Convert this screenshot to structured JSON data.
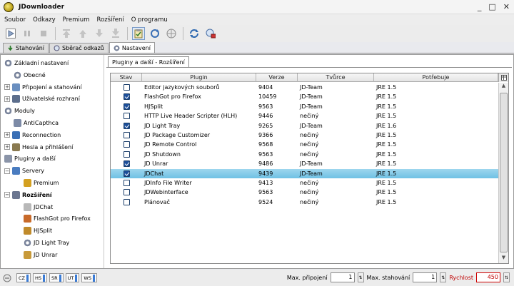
{
  "window": {
    "title": "JDownloader",
    "minimize": "_",
    "maximize": "□",
    "close": "✕"
  },
  "menu": [
    "Soubor",
    "Odkazy",
    "Premium",
    "Rozšíření",
    "O programu"
  ],
  "tabs": [
    {
      "label": "Stahování",
      "icon": "download-icon"
    },
    {
      "label": "Sběrač odkazů",
      "icon": "link-grabber-icon"
    },
    {
      "label": "Nastavení",
      "icon": "settings-icon",
      "active": true
    }
  ],
  "sidebar": {
    "items": [
      {
        "label": "Základní nastavení",
        "icon": "gear-icon",
        "indent": 0,
        "expander": ""
      },
      {
        "label": "Obecné",
        "icon": "gear-icon",
        "indent": 1,
        "expander": ""
      },
      {
        "label": "Připojení a stahování",
        "icon": "network-icon",
        "indent": 0,
        "expander": "⊞"
      },
      {
        "label": "Uživatelské rozhraní",
        "icon": "monitor-icon",
        "indent": 0,
        "expander": "⊞"
      },
      {
        "label": "Moduly",
        "icon": "gear-icon",
        "indent": 0,
        "expander": ""
      },
      {
        "label": "AntiCapthca",
        "icon": "pencil-icon",
        "indent": 1,
        "expander": ""
      },
      {
        "label": "Reconnection",
        "icon": "reconnect-icon",
        "indent": 0,
        "expander": "⊞"
      },
      {
        "label": "Hesla a přihlášení",
        "icon": "edit-icon",
        "indent": 0,
        "expander": "⊞"
      },
      {
        "label": "Pluginy a další",
        "icon": "plugin-icon",
        "indent": 0,
        "expander": ""
      },
      {
        "label": "Servery",
        "icon": "globe-icon",
        "indent": 0,
        "expander": "⊟"
      },
      {
        "label": "Premium",
        "icon": "key-icon",
        "indent": 2,
        "expander": ""
      },
      {
        "label": "Rozšíření",
        "icon": "extension-icon",
        "indent": 0,
        "expander": "⊟",
        "bold": true
      },
      {
        "label": "JDChat",
        "icon": "chat-icon",
        "indent": 2,
        "expander": ""
      },
      {
        "label": "FlashGot pro Firefox",
        "icon": "flashgot-icon",
        "indent": 2,
        "expander": ""
      },
      {
        "label": "HJSplit",
        "icon": "split-icon",
        "indent": 2,
        "expander": ""
      },
      {
        "label": "JD Light Tray",
        "icon": "gear-icon",
        "indent": 2,
        "expander": ""
      },
      {
        "label": "JD Unrar",
        "icon": "archive-icon",
        "indent": 2,
        "expander": ""
      }
    ]
  },
  "panel": {
    "tab_label": "Pluginy a další - Rozšíření"
  },
  "table": {
    "columns": [
      "Stav",
      "Plugin",
      "Verze",
      "Tvůrce",
      "Potřebuje"
    ],
    "rows": [
      {
        "checked": false,
        "plugin": "Editor jazykových souborů",
        "version": "9404",
        "author": "JD-Team",
        "requires": "JRE 1.5"
      },
      {
        "checked": true,
        "plugin": "FlashGot pro Firefox",
        "version": "10459",
        "author": "JD-Team",
        "requires": "JRE 1.5"
      },
      {
        "checked": true,
        "plugin": "HJSplit",
        "version": "9563",
        "author": "JD-Team",
        "requires": "JRE 1.5"
      },
      {
        "checked": false,
        "plugin": "HTTP Live Header Scripter (HLH)",
        "version": "9446",
        "author": "nečiný",
        "requires": "JRE 1.5"
      },
      {
        "checked": true,
        "plugin": "JD Light Tray",
        "version": "9265",
        "author": "JD-Team",
        "requires": "JRE 1.6"
      },
      {
        "checked": false,
        "plugin": "JD Package Customizer",
        "version": "9366",
        "author": "nečiný",
        "requires": "JRE 1.5"
      },
      {
        "checked": false,
        "plugin": "JD Remote Control",
        "version": "9568",
        "author": "nečiný",
        "requires": "JRE 1.5"
      },
      {
        "checked": false,
        "plugin": "JD Shutdown",
        "version": "9563",
        "author": "nečiný",
        "requires": "JRE 1.5"
      },
      {
        "checked": true,
        "plugin": "JD Unrar",
        "version": "9486",
        "author": "JD-Team",
        "requires": "JRE 1.5"
      },
      {
        "checked": true,
        "plugin": "JDChat",
        "version": "9439",
        "author": "JD-Team",
        "requires": "JRE 1.5",
        "selected": true
      },
      {
        "checked": false,
        "plugin": "JDInfo File Writer",
        "version": "9413",
        "author": "nečiný",
        "requires": "JRE 1.5"
      },
      {
        "checked": false,
        "plugin": "JDWebinterface",
        "version": "9563",
        "author": "nečiný",
        "requires": "JRE 1.5"
      },
      {
        "checked": false,
        "plugin": "Plánovač",
        "version": "9524",
        "author": "nečiný",
        "requires": "JRE 1.5"
      }
    ]
  },
  "statusbar": {
    "modules": [
      "CZ",
      "HS",
      "SR",
      "UT",
      "WS"
    ],
    "max_connections_label": "Max. připojení",
    "max_connections_value": "1",
    "max_downloads_label": "Max. stahování",
    "max_downloads_value": "1",
    "speed_label": "Rychlost",
    "speed_value": "450"
  },
  "colors": {
    "selected_row": "#7fc8e8",
    "checkbox_on": "#1d4f9a",
    "speed_red": "#c00000"
  }
}
